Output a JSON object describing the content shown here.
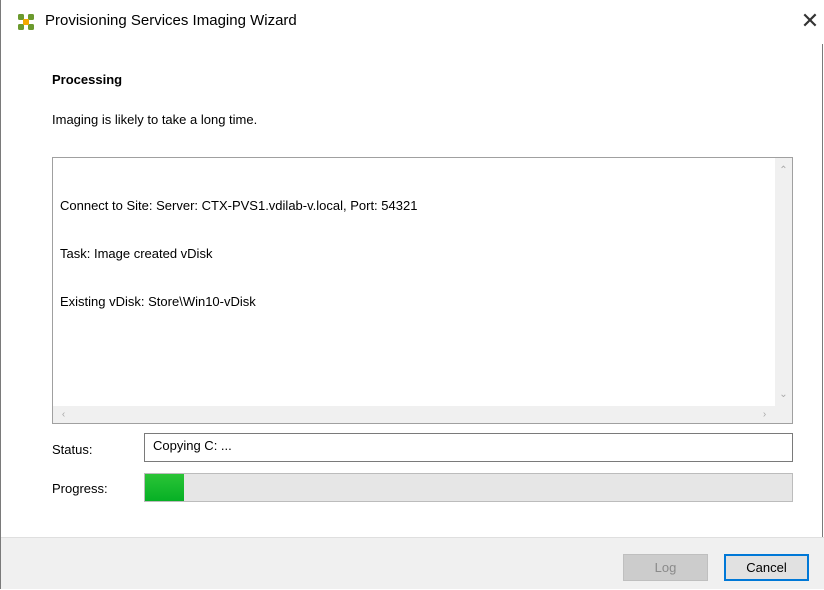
{
  "window": {
    "title": "Provisioning Services Imaging Wizard",
    "icon": "citrix-app-icon",
    "close_label": "✕"
  },
  "page": {
    "heading": "Processing",
    "description": "Imaging is likely to take a long time."
  },
  "log": {
    "lines": [
      "Connect to Site: Server: CTX-PVS1.vdilab-v.local, Port: 54321",
      "Task: Image created vDisk",
      "Existing vDisk: Store\\Win10-vDisk"
    ]
  },
  "status": {
    "label": "Status:",
    "value": "Copying C: ..."
  },
  "progress": {
    "label": "Progress:",
    "fraction": 0.06,
    "color": "#06b025"
  },
  "buttons": {
    "log": "Log",
    "cancel": "Cancel"
  }
}
